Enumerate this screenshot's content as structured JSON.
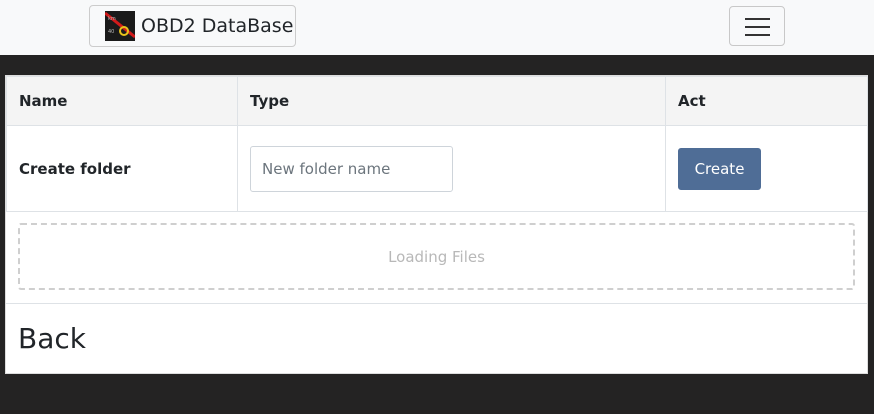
{
  "navbar": {
    "brand_text": "OBD2 DataBase",
    "logo_icon": "obd2-gauge-logo-icon",
    "menu_icon": "hamburger-menu-icon"
  },
  "table": {
    "headers": [
      "Name",
      "Type",
      "Act"
    ],
    "create_row": {
      "label": "Create folder",
      "input_value": "",
      "input_placeholder": "New folder name",
      "button_label": "Create"
    }
  },
  "files": {
    "status_text": "Loading Files"
  },
  "footer": {
    "back_label": "Back"
  },
  "colors": {
    "navbar_bg": "#f8f9fa",
    "page_bg": "#242323",
    "create_button": "#4f6d96"
  }
}
